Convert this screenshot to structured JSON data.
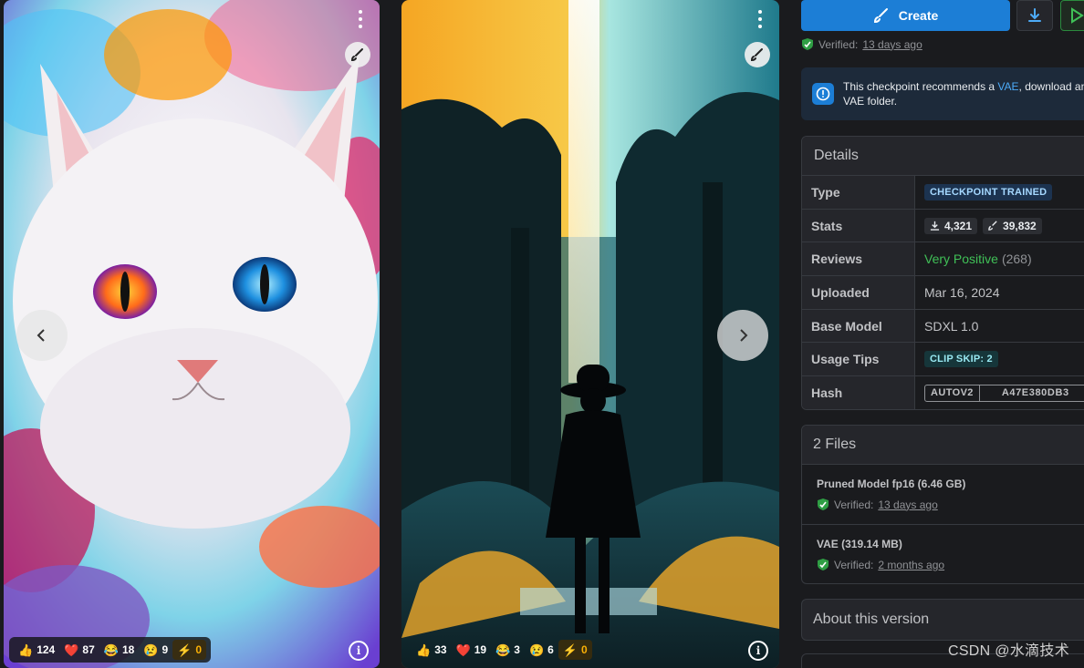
{
  "gallery": {
    "cards": [
      {
        "reactions": [
          {
            "emoji": "👍",
            "count": "124"
          },
          {
            "emoji": "❤️",
            "count": "87"
          },
          {
            "emoji": "😂",
            "count": "18"
          },
          {
            "emoji": "😢",
            "count": "9"
          },
          {
            "emoji": "⚡",
            "count": "0"
          }
        ],
        "info_glyph": "i"
      },
      {
        "reactions": [
          {
            "emoji": "👍",
            "count": "33"
          },
          {
            "emoji": "❤️",
            "count": "19"
          },
          {
            "emoji": "😂",
            "count": "3"
          },
          {
            "emoji": "😢",
            "count": "6"
          },
          {
            "emoji": "⚡",
            "count": "0"
          }
        ],
        "info_glyph": "i"
      }
    ],
    "icons": {
      "prev": "chevron-left-icon",
      "next": "chevron-right-icon",
      "remix": "brush-icon",
      "menu": "kebab-menu-icon"
    }
  },
  "sidebar": {
    "create_label": "Create",
    "verified_prefix": "Verified:",
    "verified_when": "13 days ago",
    "alert": {
      "text_before": "This checkpoint recommends a ",
      "link": "VAE",
      "text_after": ", download and",
      "line2": "VAE folder."
    },
    "details": {
      "title": "Details",
      "rows": {
        "type": {
          "label": "Type",
          "value": "CHECKPOINT TRAINED"
        },
        "stats": {
          "label": "Stats",
          "downloads": "4,321",
          "generations": "39,832"
        },
        "reviews": {
          "label": "Reviews",
          "rating": "Very Positive",
          "count": "(268)"
        },
        "uploaded": {
          "label": "Uploaded",
          "value": "Mar 16, 2024"
        },
        "base_model": {
          "label": "Base Model",
          "value": "SDXL 1.0"
        },
        "usage_tips": {
          "label": "Usage Tips",
          "value": "CLIP SKIP: 2"
        },
        "hash": {
          "label": "Hash",
          "algo": "AUTOV2",
          "value": "A47E380DB3"
        }
      }
    },
    "files": {
      "title": "2 Files",
      "items": [
        {
          "name": "Pruned Model fp16 (6.46 GB)",
          "verified_prefix": "Verified:",
          "verified_when": "13 days ago"
        },
        {
          "name": "VAE (319.14 MB)",
          "verified_prefix": "Verified:",
          "verified_when": "2 months ago"
        }
      ]
    },
    "about_title": "About this version"
  },
  "watermark": "CSDN @水滴技术",
  "colors": {
    "accent": "#1c7ed6",
    "positive": "#40c057",
    "link": "#4dabf7",
    "buzz": "#fab005"
  }
}
